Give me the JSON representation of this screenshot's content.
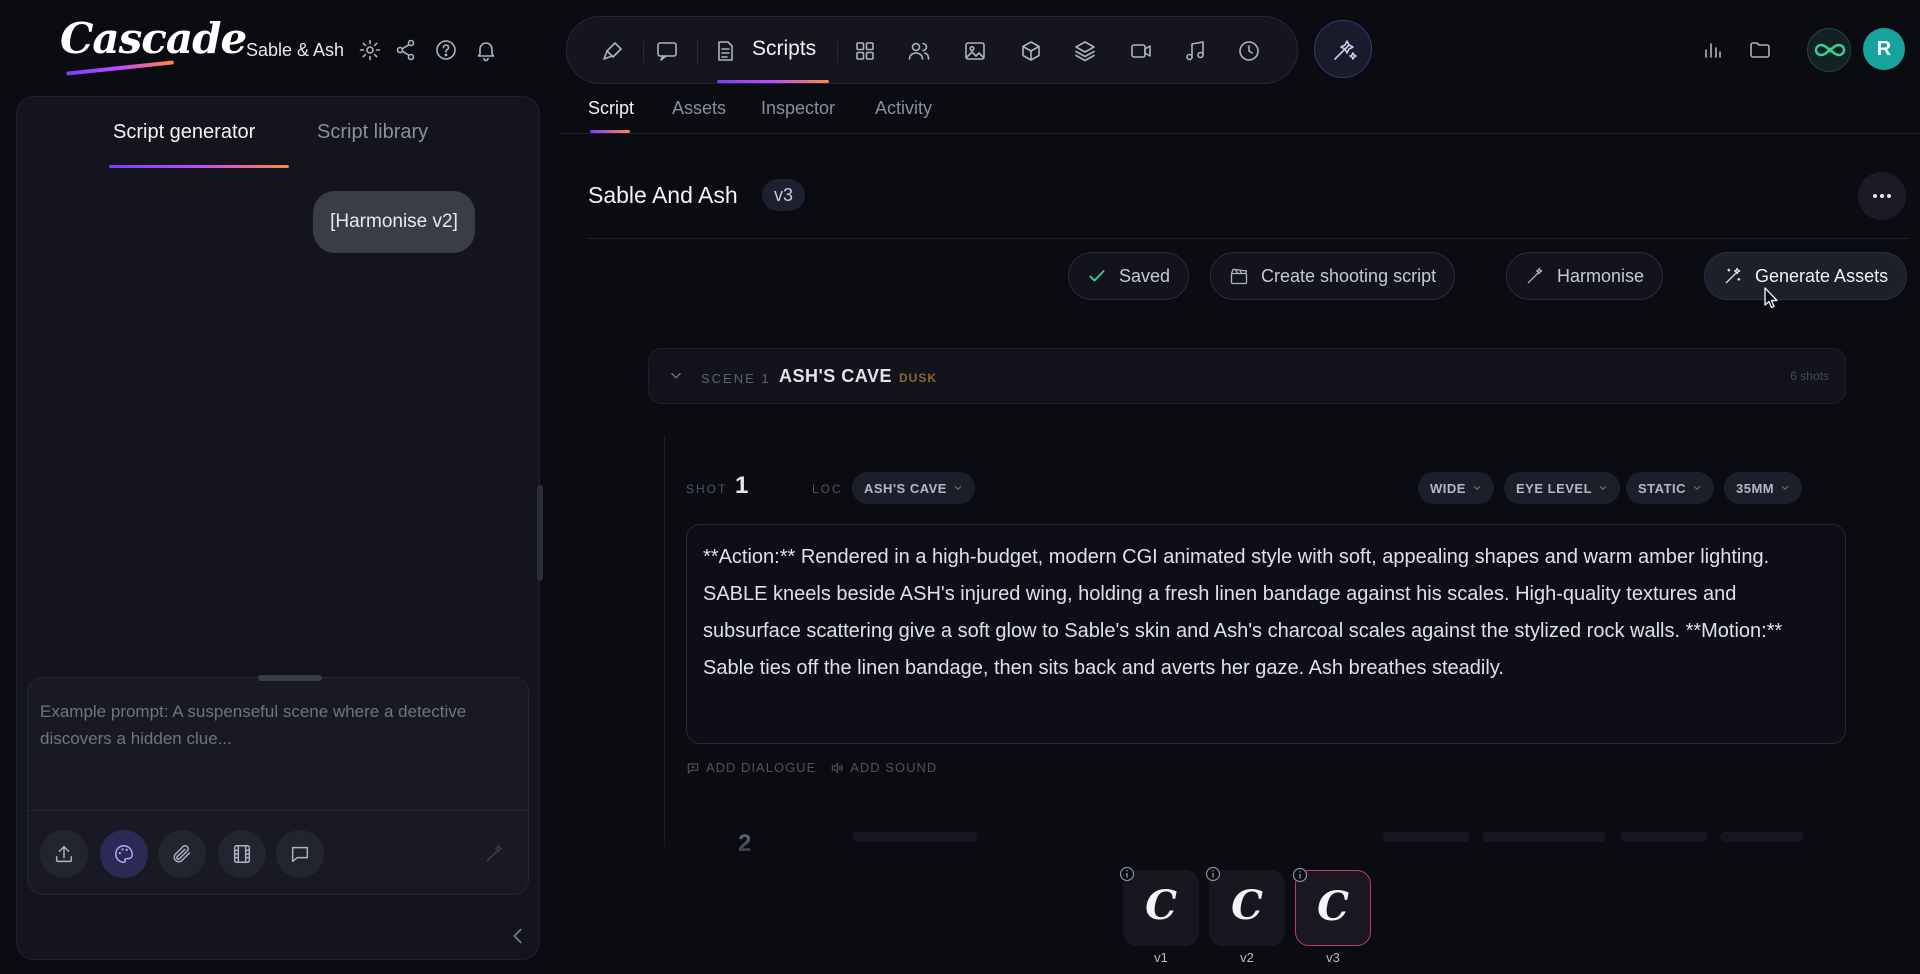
{
  "app": {
    "logo_text": "Cascade",
    "project_title": "Sable & Ash"
  },
  "header_icons": [
    "gear-icon",
    "share-icon",
    "help-icon",
    "bell-icon"
  ],
  "toolbar": {
    "active_label": "Scripts",
    "buttons": [
      "brush-icon",
      "chat-icon",
      "script-doc-icon",
      "grid-icon",
      "people-icon",
      "image-icon",
      "cube-icon",
      "layers-icon",
      "video-icon",
      "music-icon",
      "history-icon"
    ],
    "magic_button": "magic-wand-icon"
  },
  "right_icons": [
    "bar-chart-icon",
    "folder-icon",
    "infinity-icon"
  ],
  "user": {
    "avatar_initial": "R"
  },
  "left_panel": {
    "tabs": [
      {
        "label": "Script generator",
        "active": true
      },
      {
        "label": "Script library",
        "active": false
      }
    ],
    "chat_message": "[Harmonise v2]",
    "composer_placeholder": "Example prompt: A suspenseful scene where a detective discovers a hidden clue...",
    "composer_buttons": [
      "upload-icon",
      "palette-icon",
      "paperclip-icon",
      "film-icon",
      "comment-icon"
    ],
    "send_button": "magic-send-icon"
  },
  "main": {
    "tabs": [
      {
        "label": "Script",
        "active": true
      },
      {
        "label": "Assets",
        "active": false
      },
      {
        "label": "Inspector",
        "active": false
      },
      {
        "label": "Activity",
        "active": false
      }
    ],
    "script_title": "Sable And Ash",
    "version": "v3",
    "actions": {
      "saved": "Saved",
      "shooting_script": "Create shooting script",
      "harmonise": "Harmonise",
      "generate_assets": "Generate Assets"
    },
    "scene": {
      "label": "SCENE 1",
      "name": "ASH'S CAVE",
      "time": "DUSK",
      "shot_count": "6 shots"
    },
    "shot": {
      "label": "SHOT",
      "number": "1",
      "loc_label": "LOC",
      "location": "ASH'S CAVE",
      "framing": "WIDE",
      "angle": "EYE LEVEL",
      "movement": "STATIC",
      "lens": "35MM",
      "description": "**Action:** Rendered in a high-budget, modern CGI animated style with soft, appealing shapes and warm amber lighting. SABLE kneels beside ASH's injured wing, holding a fresh linen bandage against his scales. High-quality textures and subsurface scattering give a soft glow to Sable's skin and Ash's charcoal scales against the stylized rock walls. **Motion:** Sable ties off the linen bandage, then sits back and averts her gaze. Ash breathes steadily.",
      "add_dialogue": "ADD DIALOGUE",
      "add_sound": "ADD SOUND"
    },
    "next_shot_number": "2"
  },
  "versions": [
    {
      "label": "v1",
      "glyph": "C",
      "active": false
    },
    {
      "label": "v2",
      "glyph": "C",
      "active": false
    },
    {
      "label": "v3",
      "glyph": "C",
      "active": true
    }
  ],
  "colors": {
    "background": "#0b0c12",
    "accent_gradient": [
      "#7b3cff",
      "#c04bff",
      "#ff8a3c"
    ],
    "scene_time": "#8a6a2e",
    "saved_check": "#3ecf8e",
    "active_version_border": "#c03a6a"
  }
}
